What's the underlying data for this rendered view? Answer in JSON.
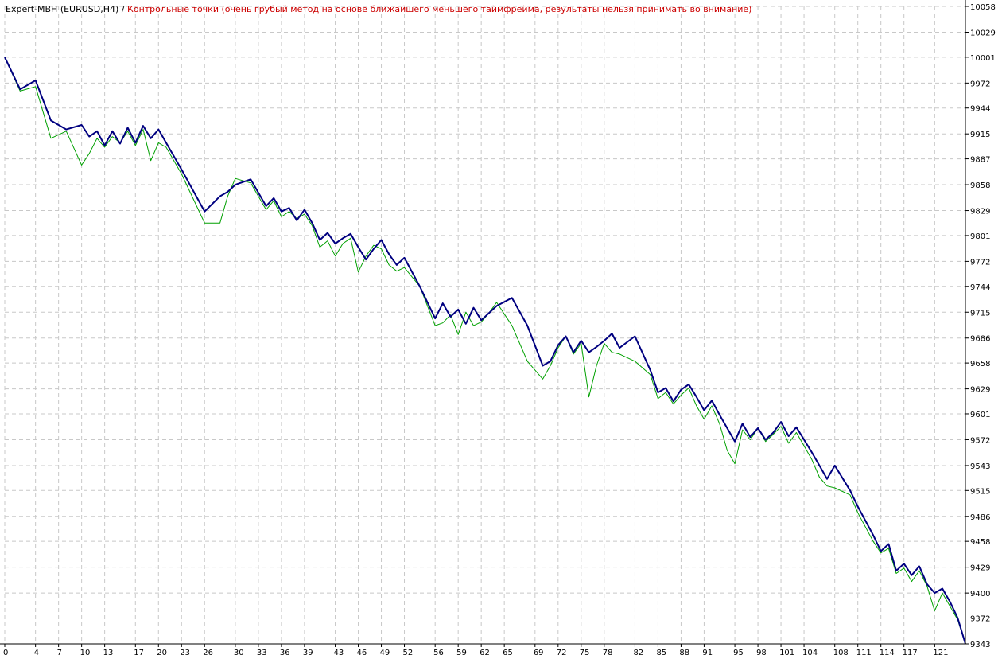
{
  "title": {
    "expert": "Expert-MBH (EURUSD,H4)",
    "separator": " / ",
    "note": "Контрольные точки (очень грубый метод на основе ближайшего меньшего таймфрейма, результаты нельзя принимать во внимание)"
  },
  "colors": {
    "balance": "#000080",
    "equity": "#00a000",
    "grid": "#c8c8c8",
    "axis": "#000000",
    "note": "#cc0000"
  },
  "chart_data": {
    "type": "line",
    "title": "Expert-MBH (EURUSD,H4) / Контрольные точки (очень грубый метод на основе ближайшего меньшего таймфрейма, результаты нельзя принимать во внимание)",
    "xlabel": "",
    "ylabel": "",
    "xlim": [
      0,
      125
    ],
    "ylim": [
      9343,
      10058
    ],
    "grid": true,
    "x_ticks": [
      0,
      4,
      7,
      10,
      13,
      17,
      20,
      23,
      26,
      30,
      33,
      36,
      39,
      43,
      46,
      49,
      52,
      56,
      59,
      62,
      65,
      69,
      72,
      75,
      78,
      82,
      85,
      88,
      91,
      95,
      98,
      101,
      104,
      108,
      111,
      114,
      117,
      121
    ],
    "y_ticks": [
      10058,
      10029,
      10001,
      9972,
      9944,
      9915,
      9887,
      9858,
      9829,
      9801,
      9772,
      9744,
      9715,
      9686,
      9658,
      9629,
      9601,
      9572,
      9543,
      9515,
      9486,
      9458,
      9429,
      9400,
      9372,
      9343
    ],
    "series": [
      {
        "type": "balance",
        "x": [
          0,
          2,
          4,
          6,
          8,
          10,
          11,
          12,
          13,
          14,
          15,
          16,
          17,
          18,
          19,
          20,
          21,
          23,
          26,
          28,
          29,
          30,
          32,
          34,
          35,
          36,
          37,
          38,
          39,
          40,
          41,
          42,
          43,
          44,
          45,
          46,
          47,
          48,
          49,
          50,
          51,
          52,
          54,
          56,
          57,
          58,
          59,
          60,
          61,
          62,
          63,
          64,
          66,
          68,
          70,
          71,
          72,
          73,
          74,
          75,
          76,
          77,
          78,
          79,
          80,
          82,
          84,
          85,
          86,
          87,
          88,
          89,
          90,
          91,
          92,
          93,
          94,
          95,
          96,
          97,
          98,
          99,
          100,
          101,
          102,
          103,
          104,
          105,
          106,
          107,
          108,
          110,
          111,
          113,
          114,
          115,
          116,
          117,
          118,
          119,
          120,
          121,
          122,
          123,
          124,
          125
        ],
        "y": [
          10001,
          9965,
          9975,
          9930,
          9920,
          9925,
          9912,
          9918,
          9902,
          9918,
          9904,
          9922,
          9905,
          9924,
          9910,
          9920,
          9905,
          9875,
          9828,
          9845,
          9850,
          9858,
          9864,
          9834,
          9843,
          9828,
          9832,
          9818,
          9830,
          9815,
          9796,
          9804,
          9792,
          9798,
          9803,
          9788,
          9774,
          9786,
          9796,
          9780,
          9768,
          9776,
          9744,
          9708,
          9725,
          9710,
          9718,
          9702,
          9720,
          9706,
          9714,
          9722,
          9731,
          9700,
          9655,
          9660,
          9678,
          9688,
          9670,
          9683,
          9670,
          9676,
          9683,
          9691,
          9675,
          9688,
          9650,
          9625,
          9630,
          9615,
          9628,
          9634,
          9620,
          9605,
          9616,
          9600,
          9585,
          9570,
          9590,
          9575,
          9585,
          9572,
          9580,
          9592,
          9576,
          9586,
          9572,
          9558,
          9543,
          9528,
          9543,
          9515,
          9497,
          9465,
          9447,
          9455,
          9425,
          9433,
          9420,
          9430,
          9410,
          9400,
          9405,
          9390,
          9372,
          9343
        ]
      },
      {
        "type": "equity",
        "x": [
          0,
          2,
          4,
          6,
          8,
          10,
          11,
          12,
          13,
          14,
          15,
          16,
          17,
          18,
          19,
          20,
          21,
          23,
          26,
          28,
          29,
          30,
          32,
          34,
          35,
          36,
          37,
          38,
          39,
          40,
          41,
          42,
          43,
          44,
          45,
          46,
          47,
          48,
          49,
          50,
          51,
          52,
          54,
          56,
          57,
          58,
          59,
          60,
          61,
          62,
          63,
          64,
          66,
          68,
          70,
          71,
          72,
          73,
          74,
          75,
          76,
          77,
          78,
          79,
          80,
          82,
          84,
          85,
          86,
          87,
          88,
          89,
          90,
          91,
          92,
          93,
          94,
          95,
          96,
          97,
          98,
          99,
          100,
          101,
          102,
          103,
          104,
          105,
          106,
          107,
          108,
          110,
          111,
          113,
          114,
          115,
          116,
          117,
          118,
          119,
          120,
          121,
          122,
          123,
          124,
          125
        ],
        "y": [
          10001,
          9963,
          9968,
          9910,
          9918,
          9880,
          9893,
          9910,
          9900,
          9912,
          9905,
          9918,
          9902,
          9920,
          9885,
          9905,
          9900,
          9870,
          9815,
          9815,
          9845,
          9865,
          9860,
          9830,
          9840,
          9822,
          9828,
          9820,
          9825,
          9812,
          9788,
          9795,
          9778,
          9792,
          9798,
          9760,
          9778,
          9790,
          9786,
          9768,
          9761,
          9765,
          9744,
          9700,
          9703,
          9712,
          9690,
          9715,
          9700,
          9704,
          9714,
          9726,
          9700,
          9660,
          9640,
          9655,
          9675,
          9688,
          9668,
          9680,
          9620,
          9655,
          9680,
          9670,
          9668,
          9660,
          9645,
          9618,
          9625,
          9612,
          9622,
          9630,
          9610,
          9595,
          9610,
          9590,
          9560,
          9545,
          9583,
          9572,
          9585,
          9570,
          9578,
          9587,
          9568,
          9580,
          9565,
          9550,
          9530,
          9520,
          9518,
          9510,
          9490,
          9458,
          9445,
          9450,
          9422,
          9428,
          9413,
          9425,
          9408,
          9380,
          9400,
          9385,
          9370,
          9343
        ]
      }
    ]
  }
}
